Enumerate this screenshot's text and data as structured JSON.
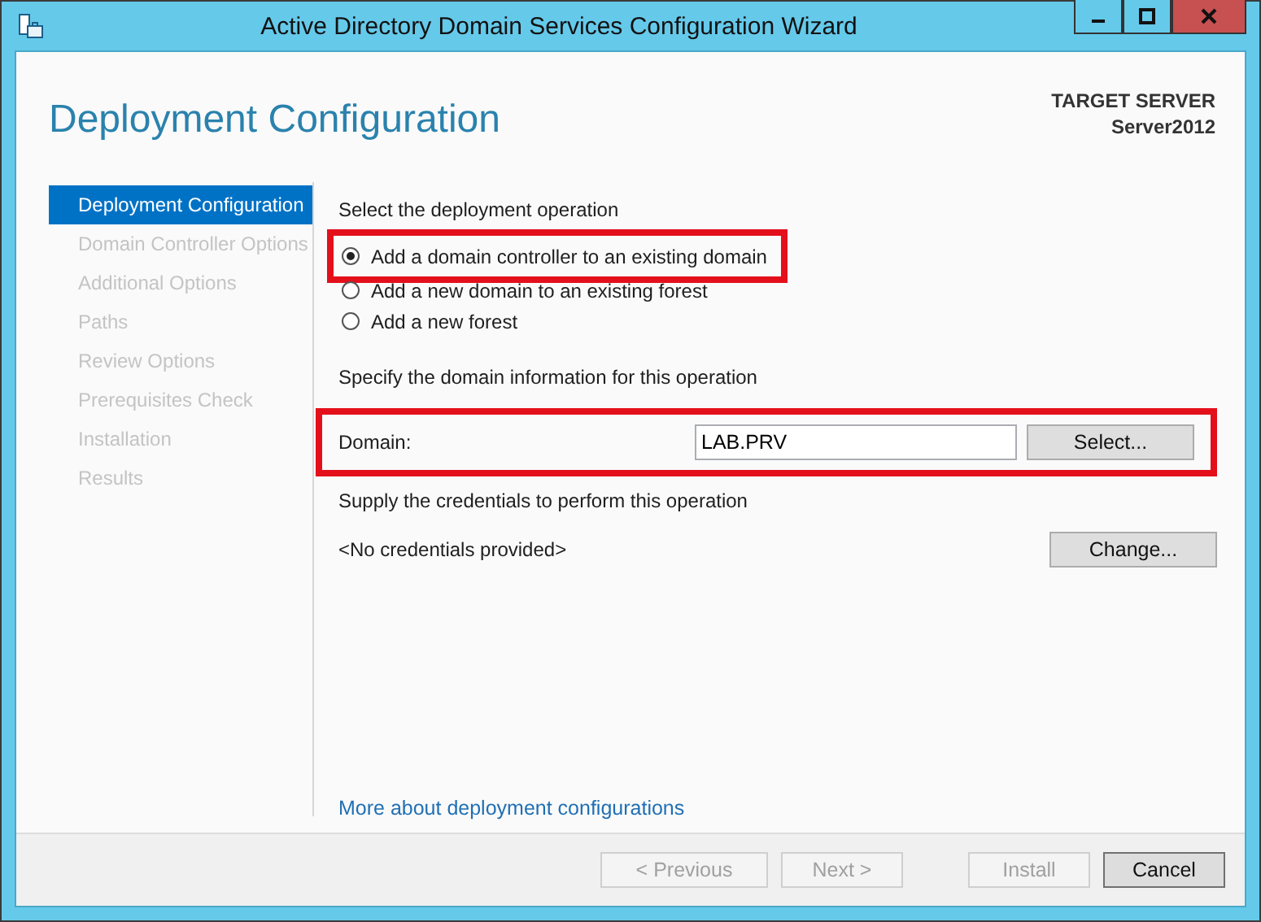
{
  "window": {
    "title": "Active Directory Domain Services Configuration Wizard"
  },
  "header": {
    "title": "Deployment Configuration",
    "target_label": "TARGET SERVER",
    "target_name": "Server2012"
  },
  "sidebar": {
    "items": [
      {
        "label": "Deployment Configuration",
        "selected": true,
        "disabled": false
      },
      {
        "label": "Domain Controller Options",
        "selected": false,
        "disabled": true
      },
      {
        "label": "Additional Options",
        "selected": false,
        "disabled": true
      },
      {
        "label": "Paths",
        "selected": false,
        "disabled": true
      },
      {
        "label": "Review Options",
        "selected": false,
        "disabled": true
      },
      {
        "label": "Prerequisites Check",
        "selected": false,
        "disabled": true
      },
      {
        "label": "Installation",
        "selected": false,
        "disabled": true
      },
      {
        "label": "Results",
        "selected": false,
        "disabled": true
      }
    ]
  },
  "operation": {
    "heading": "Select the deployment operation",
    "options": [
      {
        "label": "Add a domain controller to an existing domain",
        "selected": true,
        "highlighted": true
      },
      {
        "label": "Add a new domain to an existing forest",
        "selected": false,
        "highlighted": false
      },
      {
        "label": "Add a new forest",
        "selected": false,
        "highlighted": false
      }
    ]
  },
  "domain": {
    "heading": "Specify the domain information for this operation",
    "label": "Domain:",
    "value": "LAB.PRV",
    "button": "Select...",
    "highlighted": true
  },
  "credentials": {
    "heading": "Supply the credentials to perform this operation",
    "status": "<No credentials provided>",
    "button": "Change..."
  },
  "link": "More about deployment configurations",
  "footer": {
    "buttons": [
      {
        "label": "< Previous",
        "disabled": true
      },
      {
        "label": "Next >",
        "disabled": true
      },
      {
        "label": "Install",
        "disabled": true
      },
      {
        "label": "Cancel",
        "disabled": false
      }
    ]
  }
}
